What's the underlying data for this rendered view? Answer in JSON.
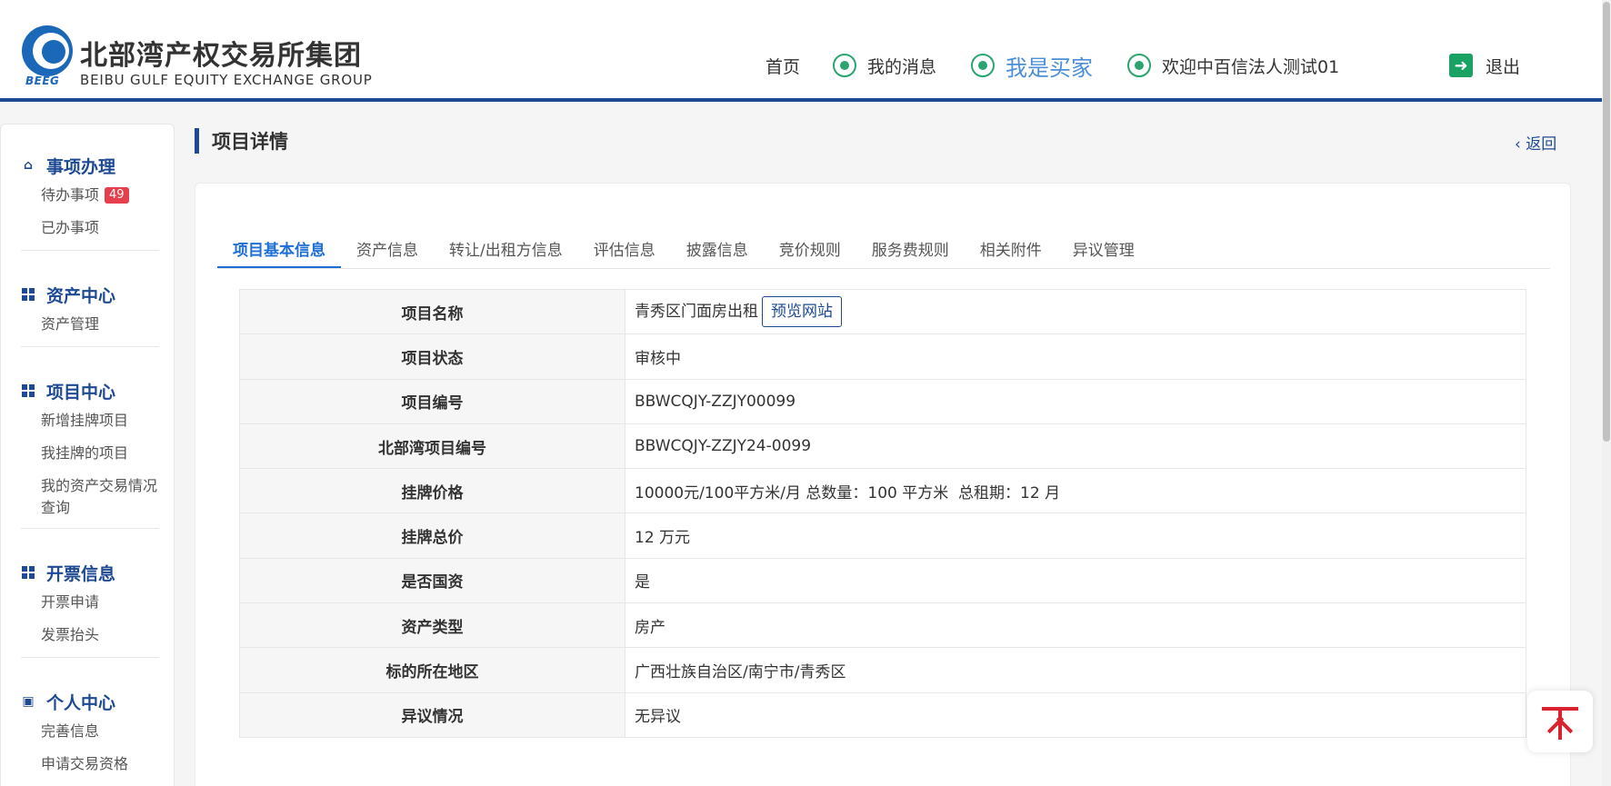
{
  "header": {
    "logo_mark": "BEEG",
    "logo_cn": "北部湾产权交易所集团",
    "logo_en": "BEIBU GULF EQUITY EXCHANGE GROUP",
    "nav": {
      "home": "首页",
      "messages": "我的消息",
      "buyer": "我是买家",
      "welcome": "欢迎中百信法人测试01",
      "logout": "退出"
    }
  },
  "sidebar": {
    "groups": [
      {
        "title": "事项办理",
        "icon": "home-icon",
        "items": [
          {
            "label": "待办事项",
            "badge": "49"
          },
          {
            "label": "已办事项"
          }
        ]
      },
      {
        "title": "资产中心",
        "icon": "grid-icon",
        "items": [
          {
            "label": "资产管理"
          }
        ]
      },
      {
        "title": "项目中心",
        "icon": "grid-icon",
        "items": [
          {
            "label": "新增挂牌项目"
          },
          {
            "label": "我挂牌的项目"
          },
          {
            "label": "我的资产交易情况查询"
          }
        ]
      },
      {
        "title": "开票信息",
        "icon": "grid-icon",
        "items": [
          {
            "label": "开票申请"
          },
          {
            "label": "发票抬头"
          }
        ]
      },
      {
        "title": "个人中心",
        "icon": "contact-book-icon",
        "items": [
          {
            "label": "完善信息"
          },
          {
            "label": "申请交易资格"
          }
        ]
      }
    ]
  },
  "main": {
    "title": "项目详情",
    "back": "返回",
    "tabs": [
      "项目基本信息",
      "资产信息",
      "转让/出租方信息",
      "评估信息",
      "披露信息",
      "竞价规则",
      "服务费规则",
      "相关附件",
      "异议管理"
    ],
    "active_tab": "项目基本信息",
    "preview_button": "预览网站",
    "rows": [
      {
        "key": "项目名称",
        "value": "青秀区门面房出租"
      },
      {
        "key": "项目状态",
        "value": "审核中"
      },
      {
        "key": "项目编号",
        "value": "BBWCQJY-ZZJY00099"
      },
      {
        "key": "北部湾项目编号",
        "value": "BBWCQJY-ZZJY24-0099"
      },
      {
        "key": "挂牌价格",
        "value": "10000元/100平方米/月 总数量：100 平方米  总租期：12 月"
      },
      {
        "key": "挂牌总价",
        "value": "12 万元"
      },
      {
        "key": "是否国资",
        "value": "是"
      },
      {
        "key": "资产类型",
        "value": "房产"
      },
      {
        "key": "标的所在地区",
        "value": "广西壮族自治区/南宁市/青秀区"
      },
      {
        "key": "异议情况",
        "value": "无异议"
      }
    ]
  },
  "colors": {
    "brand": "#1d4a93",
    "accent_tab": "#1d6fd6",
    "badge": "#e53e4c",
    "nav_icon": "#2aa56f",
    "back_to_top": "#d9232e"
  }
}
